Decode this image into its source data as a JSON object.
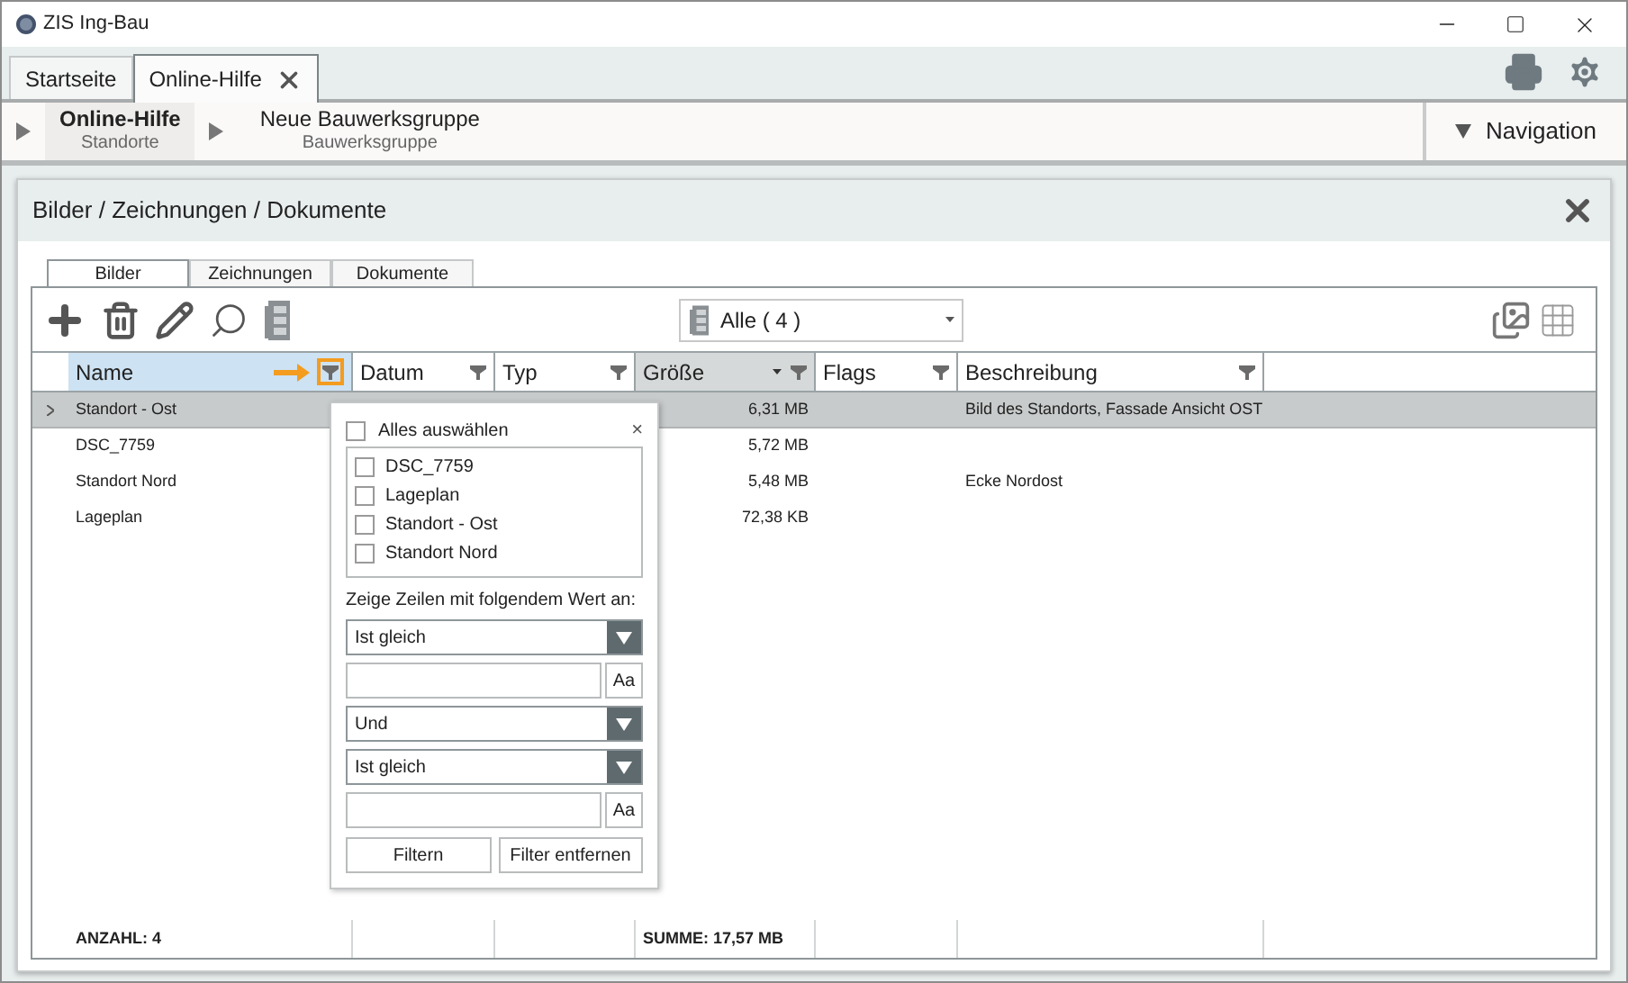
{
  "window": {
    "title": "ZIS Ing-Bau"
  },
  "tabs": [
    {
      "label": "Startseite",
      "selected": false,
      "closable": false
    },
    {
      "label": "Online-Hilfe",
      "selected": true,
      "closable": true
    }
  ],
  "breadcrumb": [
    {
      "title": "Online-Hilfe",
      "subtitle": "Standorte",
      "selected": true
    },
    {
      "title": "Neue Bauwerksgruppe",
      "subtitle": "Bauwerksgruppe",
      "selected": false
    }
  ],
  "navigation_button": "Navigation",
  "panel": {
    "title": "Bilder / Zeichnungen / Dokumente",
    "tabs": [
      {
        "label": "Bilder",
        "selected": true
      },
      {
        "label": "Zeichnungen",
        "selected": false
      },
      {
        "label": "Dokumente",
        "selected": false
      }
    ],
    "dropdown": "Alle ( 4 )",
    "columns": [
      {
        "label": "Name",
        "selected": true,
        "filter_active": true,
        "sorted": false
      },
      {
        "label": "Datum",
        "selected": false,
        "filter_active": false,
        "sorted": false
      },
      {
        "label": "Typ",
        "selected": false,
        "filter_active": false,
        "sorted": false
      },
      {
        "label": "Größe",
        "selected": false,
        "filter_active": false,
        "sorted": true
      },
      {
        "label": "Flags",
        "selected": false,
        "filter_active": false,
        "sorted": false
      },
      {
        "label": "Beschreibung",
        "selected": false,
        "filter_active": false,
        "sorted": false
      }
    ],
    "rows": [
      {
        "selected": true,
        "name": "Standort - Ost",
        "size": "6,31 MB",
        "description": "Bild des Standorts, Fassade Ansicht OST"
      },
      {
        "selected": false,
        "name": "DSC_7759",
        "size": "5,72 MB"
      },
      {
        "selected": false,
        "name": "Standort Nord",
        "size": "5,48 MB",
        "description": "Ecke Nordost"
      },
      {
        "selected": false,
        "name": "Lageplan",
        "size": "72,38 KB"
      }
    ],
    "footer": {
      "name": "ANZAHL: 4",
      "size": "SUMME: 17,57 MB"
    },
    "filter_popup": {
      "select_all": {
        "label": "Alles auswählen",
        "checked": false
      },
      "close": "×",
      "values": [
        {
          "label": "DSC_7759",
          "checked": false
        },
        {
          "label": "Lageplan",
          "checked": false
        },
        {
          "label": "Standort - Ost",
          "checked": false
        },
        {
          "label": "Standort Nord",
          "checked": false
        }
      ],
      "condition_label": "Zeige Zeilen mit folgendem Wert an:",
      "conditions": [
        {
          "kind": "select",
          "value": "Ist gleich"
        },
        {
          "kind": "text",
          "case_button": "Aa"
        },
        {
          "kind": "select",
          "value": "Und"
        },
        {
          "kind": "select",
          "value": "Ist gleich"
        },
        {
          "kind": "text",
          "case_button": "Aa"
        }
      ],
      "buttons": [
        "Filtern",
        "Filter entfernen"
      ]
    }
  }
}
